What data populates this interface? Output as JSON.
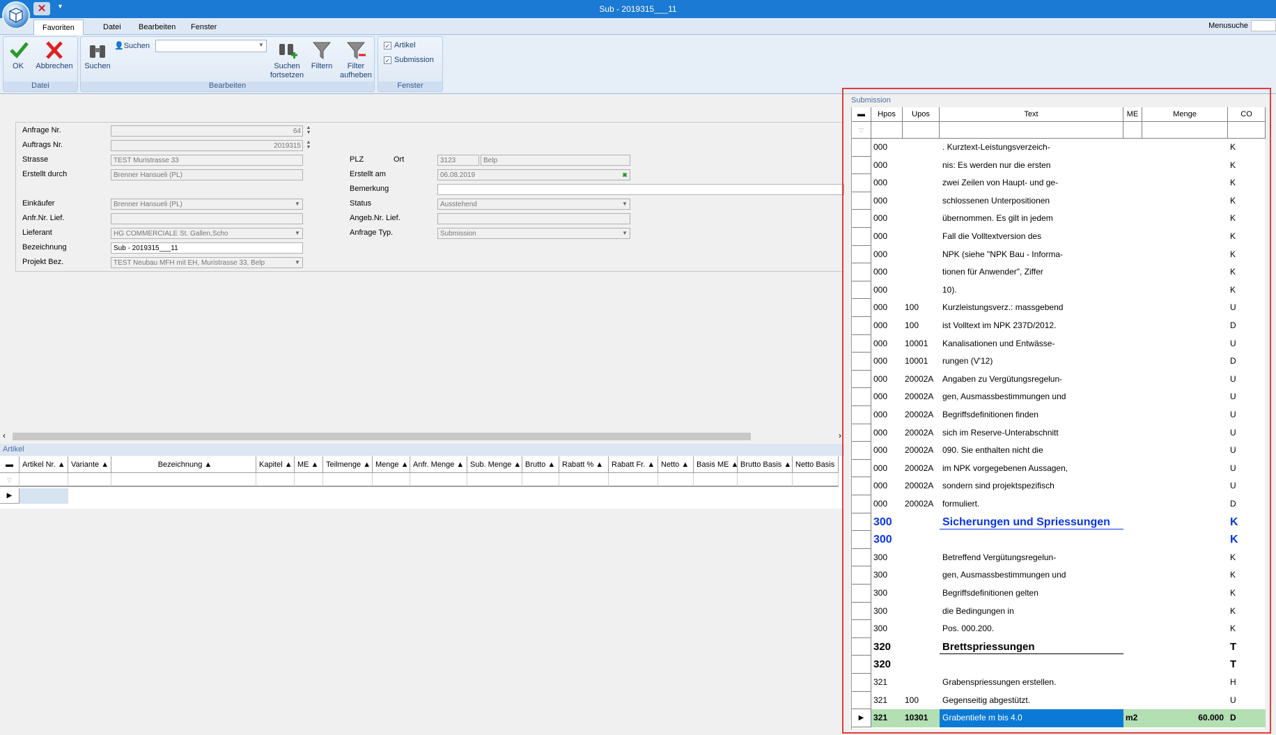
{
  "window": {
    "title": "Sub - 2019315___11"
  },
  "menu": {
    "tabs": [
      "Favoriten",
      "Datei",
      "Bearbeiten",
      "Fenster"
    ],
    "active": "Favoriten",
    "search_label": "Menusuche"
  },
  "ribbon": {
    "groups": {
      "datei": "Datei",
      "bearbeiten": "Bearbeiten",
      "fenster": "Fenster"
    },
    "ok": "OK",
    "abbrechen": "Abbrechen",
    "suchen": "Suchen",
    "suchen_small": "Suchen",
    "suchen_fortsetzen": [
      "Suchen",
      "fortsetzen"
    ],
    "filtern": "Filtern",
    "filter_aufheben": [
      "Filter",
      "aufheben"
    ],
    "chk_artikel": "Artikel",
    "chk_submission": "Submission"
  },
  "form": {
    "anfrage_nr": {
      "label": "Anfrage Nr.",
      "value": "64"
    },
    "auftrags_nr": {
      "label": "Auftrags Nr.",
      "value": "2019315"
    },
    "strasse": {
      "label": "Strasse",
      "value": "TEST Muristrasse 33"
    },
    "erstellt_durch": {
      "label": "Erstellt durch",
      "value": "Brenner Hansueli (PL)"
    },
    "einkaeufer": {
      "label": "Einkäufer",
      "value": "Brenner Hansueli (PL)"
    },
    "anfr_nr_lief": {
      "label": "Anfr.Nr. Lief.",
      "value": ""
    },
    "lieferant": {
      "label": "Lieferant",
      "value": "HG COMMERCIALE St. Gallen,Scho"
    },
    "bezeichnung": {
      "label": "Bezeichnung",
      "value": "Sub - 2019315___11"
    },
    "projekt_bez": {
      "label": "Projekt Bez.",
      "value": "TEST Neubau MFH mit EH, Muristrasse 33, Belp"
    },
    "plz": {
      "label": "PLZ",
      "value": "3123"
    },
    "ort": {
      "label": "Ort",
      "value": "Belp"
    },
    "erstellt_am": {
      "label": "Erstellt am",
      "value": "06.08.2019"
    },
    "bemerkung": {
      "label": "Bemerkung",
      "value": ""
    },
    "status": {
      "label": "Status",
      "value": "Ausstehend"
    },
    "angeb_nr_lief": {
      "label": "Angeb.Nr. Lief.",
      "value": ""
    },
    "anfrage_typ": {
      "label": "Anfrage Typ.",
      "value": "Submission"
    }
  },
  "artikel": {
    "caption": "Artikel",
    "columns": [
      "Artikel Nr.",
      "Variante",
      "Bezeichnung",
      "Kapitel",
      "ME",
      "Teilmenge",
      "Menge",
      "Anfr. Menge",
      "Sub. Menge",
      "Brutto",
      "Rabatt %",
      "Rabatt Fr.",
      "Netto",
      "Basis ME",
      "Brutto Basis",
      "Netto Basis"
    ]
  },
  "submission": {
    "caption": "Submission",
    "columns": {
      "hpos": "Hpos",
      "upos": "Upos",
      "text": "Text",
      "me": "ME",
      "menge": "Menge",
      "co": "CO"
    },
    "rows": [
      {
        "hpos": "000",
        "upos": "",
        "text": ". Kurztext-Leistungsverzeich-",
        "me": "",
        "menge": "",
        "co": "K"
      },
      {
        "hpos": "000",
        "upos": "",
        "text": "nis: Es werden nur die ersten",
        "me": "",
        "menge": "",
        "co": "K"
      },
      {
        "hpos": "000",
        "upos": "",
        "text": "zwei Zeilen von Haupt- und ge-",
        "me": "",
        "menge": "",
        "co": "K"
      },
      {
        "hpos": "000",
        "upos": "",
        "text": "schlossenen Unterpositionen",
        "me": "",
        "menge": "",
        "co": "K"
      },
      {
        "hpos": "000",
        "upos": "",
        "text": "übernommen. Es gilt in jedem",
        "me": "",
        "menge": "",
        "co": "K"
      },
      {
        "hpos": "000",
        "upos": "",
        "text": "Fall die Volltextversion des",
        "me": "",
        "menge": "",
        "co": "K"
      },
      {
        "hpos": "000",
        "upos": "",
        "text": "NPK (siehe \"NPK Bau - Informa-",
        "me": "",
        "menge": "",
        "co": "K"
      },
      {
        "hpos": "000",
        "upos": "",
        "text": "tionen für Anwender\", Ziffer",
        "me": "",
        "menge": "",
        "co": "K"
      },
      {
        "hpos": "000",
        "upos": "",
        "text": "10).",
        "me": "",
        "menge": "",
        "co": "K"
      },
      {
        "hpos": "000",
        "upos": "100",
        "text": "Kurzleistungsverz.: massgebend",
        "me": "",
        "menge": "",
        "co": "U"
      },
      {
        "hpos": "000",
        "upos": "100",
        "text": "ist Volltext im NPK 237D/2012.",
        "me": "",
        "menge": "",
        "co": "D"
      },
      {
        "hpos": "000",
        "upos": "10001",
        "text": "Kanalisationen und Entwässe-",
        "me": "",
        "menge": "",
        "co": "U"
      },
      {
        "hpos": "000",
        "upos": "10001",
        "text": "rungen (V'12)",
        "me": "",
        "menge": "",
        "co": "D"
      },
      {
        "hpos": "000",
        "upos": "20002A",
        "text": "Angaben zu Vergütungsregelun-",
        "me": "",
        "menge": "",
        "co": "U"
      },
      {
        "hpos": "000",
        "upos": "20002A",
        "text": "gen, Ausmassbestimmungen und",
        "me": "",
        "menge": "",
        "co": "U"
      },
      {
        "hpos": "000",
        "upos": "20002A",
        "text": "Begriffsdefinitionen finden",
        "me": "",
        "menge": "",
        "co": "U"
      },
      {
        "hpos": "000",
        "upos": "20002A",
        "text": "sich im Reserve-Unterabschnitt",
        "me": "",
        "menge": "",
        "co": "U"
      },
      {
        "hpos": "000",
        "upos": "20002A",
        "text": "090. Sie enthalten nicht die",
        "me": "",
        "menge": "",
        "co": "U"
      },
      {
        "hpos": "000",
        "upos": "20002A",
        "text": "im NPK vorgegebenen Aussagen,",
        "me": "",
        "menge": "",
        "co": "U"
      },
      {
        "hpos": "000",
        "upos": "20002A",
        "text": "sondern sind projektspezifisch",
        "me": "",
        "menge": "",
        "co": "U"
      },
      {
        "hpos": "000",
        "upos": "20002A",
        "text": "formuliert.",
        "me": "",
        "menge": "",
        "co": "D"
      },
      {
        "hpos": "300",
        "upos": "",
        "text": "Sicherungen und Spriessungen",
        "me": "",
        "menge": "",
        "co": "K",
        "style": "hdr1",
        "underline": "#0a35e6"
      },
      {
        "hpos": "300",
        "upos": "",
        "text": "",
        "me": "",
        "menge": "",
        "co": "K",
        "style": "hdr1"
      },
      {
        "hpos": "300",
        "upos": "",
        "text": "Betreffend Vergütungsregelun-",
        "me": "",
        "menge": "",
        "co": "K"
      },
      {
        "hpos": "300",
        "upos": "",
        "text": "gen, Ausmassbestimmungen und",
        "me": "",
        "menge": "",
        "co": "K"
      },
      {
        "hpos": "300",
        "upos": "",
        "text": "Begriffsdefinitionen gelten",
        "me": "",
        "menge": "",
        "co": "K"
      },
      {
        "hpos": "300",
        "upos": "",
        "text": "die Bedingungen in",
        "me": "",
        "menge": "",
        "co": "K"
      },
      {
        "hpos": "300",
        "upos": "",
        "text": "Pos. 000.200.",
        "me": "",
        "menge": "",
        "co": "K"
      },
      {
        "hpos": "320",
        "upos": "",
        "text": "Brettspriessungen",
        "me": "",
        "menge": "",
        "co": "T",
        "style": "hdr2",
        "underline": "#000000"
      },
      {
        "hpos": "320",
        "upos": "",
        "text": "",
        "me": "",
        "menge": "",
        "co": "T",
        "style": "hdr2"
      },
      {
        "hpos": "321",
        "upos": "",
        "text": "Grabenspriessungen erstellen.",
        "me": "",
        "menge": "",
        "co": "H"
      },
      {
        "hpos": "321",
        "upos": "100",
        "text": "Gegenseitig abgestützt.",
        "me": "",
        "menge": "",
        "co": "U"
      },
      {
        "hpos": "321",
        "upos": "10301",
        "text": "Grabentiefe m bis 4.0",
        "me": "m2",
        "menge": "60.000",
        "co": "D",
        "style": "current"
      }
    ]
  }
}
